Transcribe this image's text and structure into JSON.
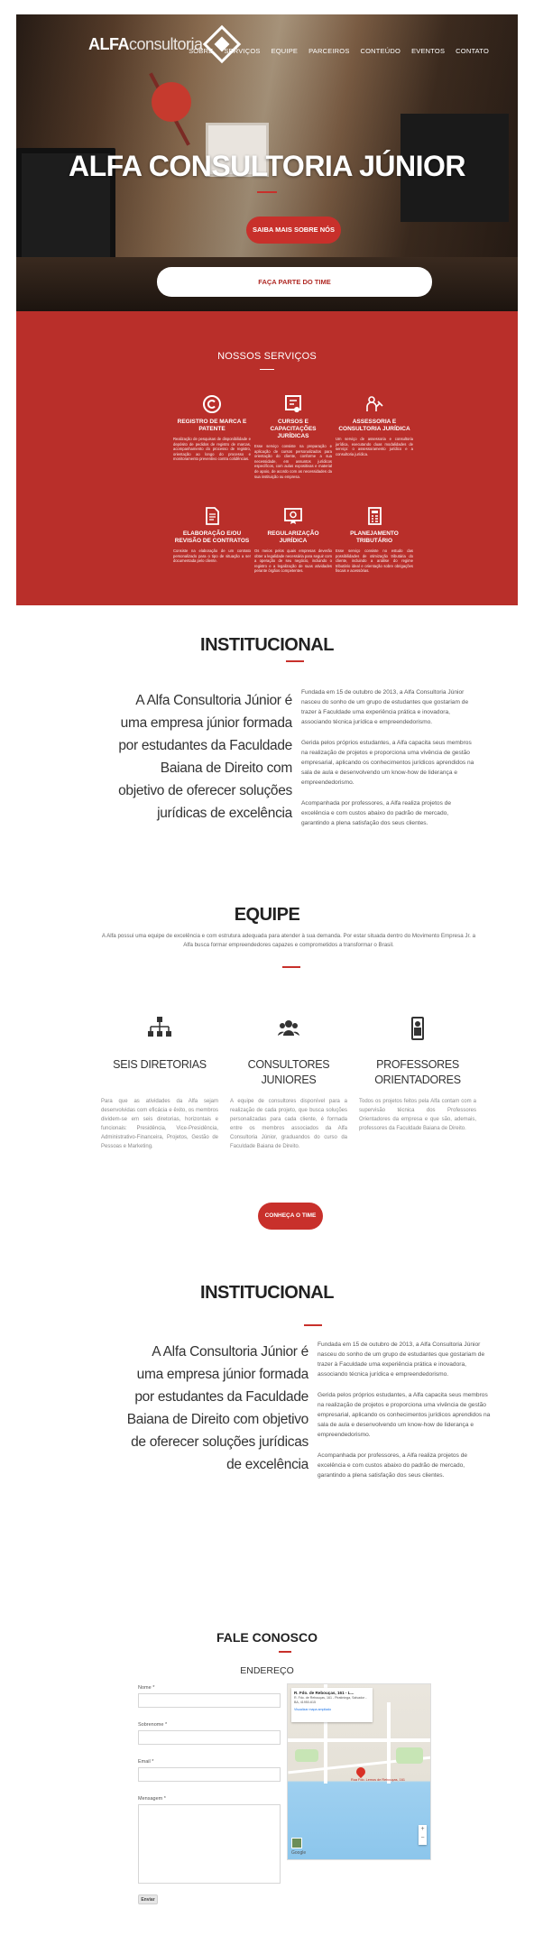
{
  "header": {
    "logo_bold": "ALFA",
    "logo_light": "consultoria",
    "nav": [
      "SOBRE",
      "SERVIÇOS",
      "EQUIPE",
      "PARCEIROS",
      "CONTEÚDO",
      "EVENTOS",
      "CONTATO"
    ],
    "active_nav": "EQUIPE"
  },
  "hero": {
    "title": "ALFA CONSULTORIA JÚNIOR",
    "primary_button": "SAIBA MAIS SOBRE NÓS",
    "secondary_button": "FAÇA PARTE DO TIME"
  },
  "services": {
    "title": "NOSSOS SERVIÇOS",
    "items": [
      {
        "icon": "copyright-icon",
        "title": "REGISTRO DE MARCA E PATENTE",
        "desc": "Realização de pesquisas de disponibilidade e depósito de pedidos de registro de marcas, acompanhamento do processo de registro, orientação ao longo do processo e monitoramento preventivo contra colidências."
      },
      {
        "icon": "certificate-icon",
        "title": "CURSOS E CAPACITAÇÕES JURÍDICAS",
        "desc": "Esse serviço consiste na preparação e aplicação de cursos personalizados para orientação do cliente, conforme a sua necessidade, em assuntos jurídicos específicos, com aulas expositivas e material de apoio, de acordo com as necessidades da sua instituição ou empresa."
      },
      {
        "icon": "legal-advisor-icon",
        "title": "ASSESSORIA E CONSULTORIA JURÍDICA",
        "desc": "Um serviço de assessoria e consultoria jurídica, executando duas modalidades de serviço: o assessoramento jurídico e a consultoria jurídica."
      },
      {
        "icon": "document-icon",
        "title": "ELABORAÇÃO E/OU REVISÃO DE CONTRATOS",
        "desc": "Consiste na elaboração de um contrato personalizado para o tipo de situação a ser documentada pelo cliente."
      },
      {
        "icon": "regularization-icon",
        "title": "REGULARIZAÇÃO JURÍDICA",
        "desc": "Os meios pelos quais empresas deverão obter a legalidade necessária para seguir com a operação de seu negócio, incluindo o registro e a legalização de suas atividades perante órgãos competentes."
      },
      {
        "icon": "calculator-icon",
        "title": "PLANEJAMENTO TRIBUTÁRIO",
        "desc": "Esse serviço consiste no estudo das possibilidades de otimização tributária do cliente, incluindo a análise do regime tributário ideal e orientação sobre obrigações fiscais e acessórias."
      }
    ]
  },
  "institucional_1": {
    "title": "INSTITUCIONAL",
    "lead": "A Alfa Consultoria Júnior é uma empresa júnior formada por estudantes da Faculdade Baiana de Direito com objetivo de oferecer soluções jurídicas de excelência",
    "paragraphs": [
      "Fundada em 15 de outubro de 2013, a Alfa Consultoria Júnior nasceu do sonho de um grupo de estudantes que gostariam de trazer à Faculdade uma experiência prática e inovadora, associando técnica jurídica e empreendedorismo.",
      "Gerida pelos próprios estudantes, a Alfa capacita seus membros na realização de projetos e proporciona uma vivência de gestão empresarial, aplicando os conhecimentos jurídicos aprendidos na sala de aula e desenvolvendo um know-how de liderança e empreendedorismo.",
      "Acompanhada por professores, a Alfa realiza projetos de excelência e com custos abaixo do padrão de mercado, garantindo a plena satisfação dos seus clientes."
    ]
  },
  "equipe": {
    "title": "EQUIPE",
    "subtitle": "A Alfa possui uma equipe de excelência e com estrutura adequada para atender à sua demanda. Por estar situada dentro do Movimento Empresa Jr. a Alfa busca formar empreendedores capazes e comprometidos a transformar o Brasil.",
    "columns": [
      {
        "icon": "org-chart-icon",
        "name": "SEIS DIRETORIAS",
        "desc": "Para que as atividades da Alfa sejam desenvolvidas com eficácia e êxito, os membros dividem-se em seis diretorias, horizontais e funcionais: Presidência, Vice-Presidência, Administrativo-Financeira, Projetos, Gestão de Pessoas e Marketing."
      },
      {
        "icon": "team-icon",
        "name": "CONSULTORES JUNIORES",
        "desc": "A equipe de consultores disponível para a realização de cada projeto, que busca soluções personalizadas para cada cliente, é formada entre os membros associados da Alfa Consultoria Júnior, graduandos do curso da Faculdade Baiana de Direito."
      },
      {
        "icon": "professor-icon",
        "name": "PROFESSORES ORIENTADORES",
        "desc": "Todos os projetos feitos pela Alfa contam com a supervisão técnica dos Professores Orientadores da empresa e que são, ademais, professores da Faculdade Baiana de Direito."
      }
    ],
    "button": "CONHEÇA O TIME"
  },
  "institucional_2": {
    "title": "INSTITUCIONAL",
    "lead": "A Alfa Consultoria Júnior é uma empresa júnior formada por estudantes da Faculdade Baiana de Direito com objetivo de oferecer soluções jurídicas de excelência",
    "paragraphs": [
      "Fundada em 15 de outubro de 2013, a Alfa Consultoria Júnior nasceu do sonho de um grupo de estudantes que gostariam de trazer à Faculdade uma experiência prática e inovadora, associando técnica jurídica e empreendedorismo.",
      "Gerida pelos próprios estudantes, a Alfa capacita seus membros na realização de projetos e proporciona uma vivência de gestão empresarial, aplicando os conhecimentos jurídicos aprendidos na sala de aula e desenvolvendo um know-how de liderança e empreendedorismo.",
      "Acompanhada por professores, a Alfa realiza projetos de excelência e com custos abaixo do padrão de mercado, garantindo a plena satisfação dos seus clientes."
    ]
  },
  "contact": {
    "title": "FALE CONOSCO",
    "address_title": "ENDEREÇO",
    "fields": {
      "name_label": "Nome *",
      "surname_label": "Sobrenome *",
      "email_label": "Email *",
      "message_label": "Mensagem *"
    },
    "submit": "Enviar",
    "map": {
      "place": "R. Fdo. de Rebouças, 161 - L...",
      "address": "R. Fdo. de Rebouças, 161 - Piratininga, Salvador - BA, 41950-615",
      "link": "Visualizar mapa ampliado",
      "pin_label": "Rua Fdo. Lemos de Rebouças, 161",
      "google": "Google"
    }
  },
  "colors": {
    "brand_red": "#c8302b",
    "services_bg": "#b92f2a"
  }
}
